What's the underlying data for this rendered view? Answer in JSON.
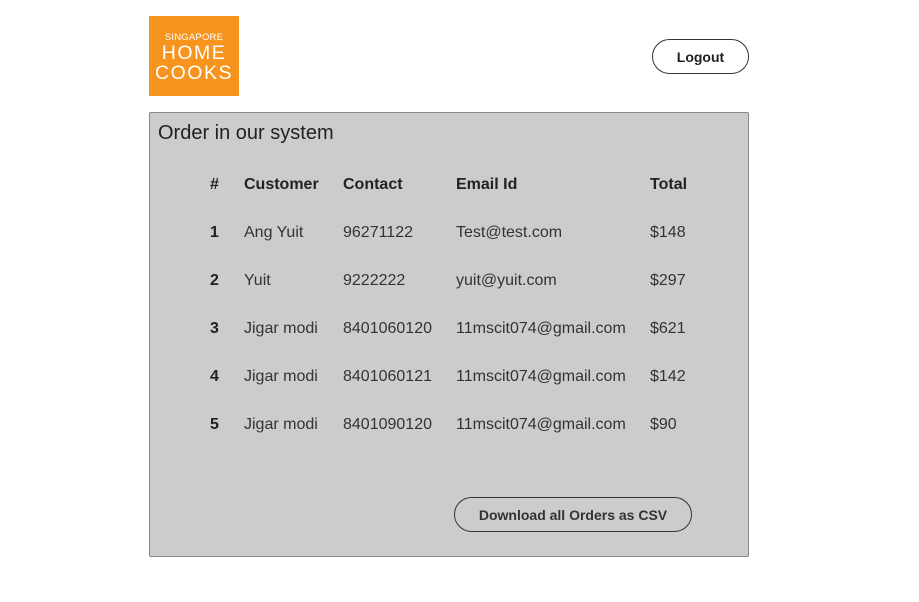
{
  "logo": {
    "line1": "SINGAPORE",
    "line2": "HOME",
    "line3": "COOKS",
    "color": "#f7941d"
  },
  "header": {
    "logout_label": "Logout"
  },
  "orders_panel": {
    "title": "Order in our system",
    "background": "#cccccc",
    "columns": {
      "index": "#",
      "customer": "Customer",
      "contact": "Contact",
      "email": "Email Id",
      "total": "Total"
    },
    "rows": [
      {
        "index": "1",
        "customer": "Ang Yuit",
        "contact": "96271122",
        "email": "Test@test.com",
        "total": "$148"
      },
      {
        "index": "2",
        "customer": "Yuit",
        "contact": "9222222",
        "email": "yuit@yuit.com",
        "total": "$297"
      },
      {
        "index": "3",
        "customer": "Jigar modi",
        "contact": "8401060120",
        "email": "11mscit074@gmail.com",
        "total": "$621"
      },
      {
        "index": "4",
        "customer": "Jigar modi",
        "contact": "8401060121",
        "email": "11mscit074@gmail.com",
        "total": "$142"
      },
      {
        "index": "5",
        "customer": "Jigar modi",
        "contact": "8401090120",
        "email": "11mscit074@gmail.com",
        "total": "$90"
      }
    ],
    "download_label": "Download all Orders as CSV"
  }
}
